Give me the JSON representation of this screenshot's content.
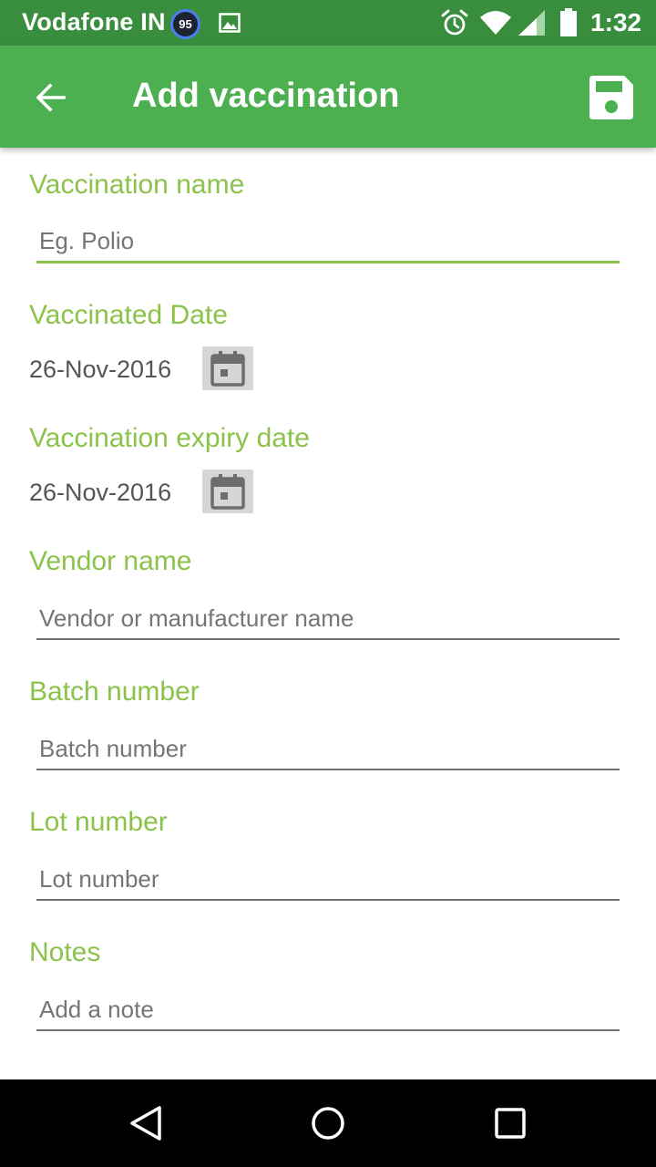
{
  "status_bar": {
    "carrier": "Vodafone IN",
    "notification_badge": "95",
    "time": "1:32",
    "icons": [
      "gallery-icon",
      "alarm-icon",
      "wifi-icon",
      "signal-icon",
      "battery-icon"
    ]
  },
  "app_bar": {
    "title": "Add vaccination",
    "icons": [
      "arrow-back-icon",
      "save-icon"
    ]
  },
  "form": {
    "vaccination_name": {
      "label": "Vaccination name",
      "placeholder": "Eg. Polio",
      "value": ""
    },
    "vaccinated_date": {
      "label": "Vaccinated Date",
      "value": "26-Nov-2016"
    },
    "expiry_date": {
      "label": "Vaccination expiry date",
      "value": "26-Nov-2016"
    },
    "vendor_name": {
      "label": "Vendor name",
      "placeholder": "Vendor or manufacturer name",
      "value": ""
    },
    "batch_number": {
      "label": "Batch number",
      "placeholder": "Batch number",
      "value": ""
    },
    "lot_number": {
      "label": "Lot number",
      "placeholder": "Lot number",
      "value": ""
    },
    "notes": {
      "label": "Notes",
      "placeholder": "Add a note",
      "value": ""
    }
  },
  "colors": {
    "status_bar": "#388e3c",
    "app_bar": "#4caf50",
    "accent_label": "#8bc34a",
    "nav_bar": "#000000"
  },
  "nav_bar": {
    "icons": [
      "nav-back-icon",
      "nav-home-icon",
      "nav-recents-icon"
    ]
  }
}
